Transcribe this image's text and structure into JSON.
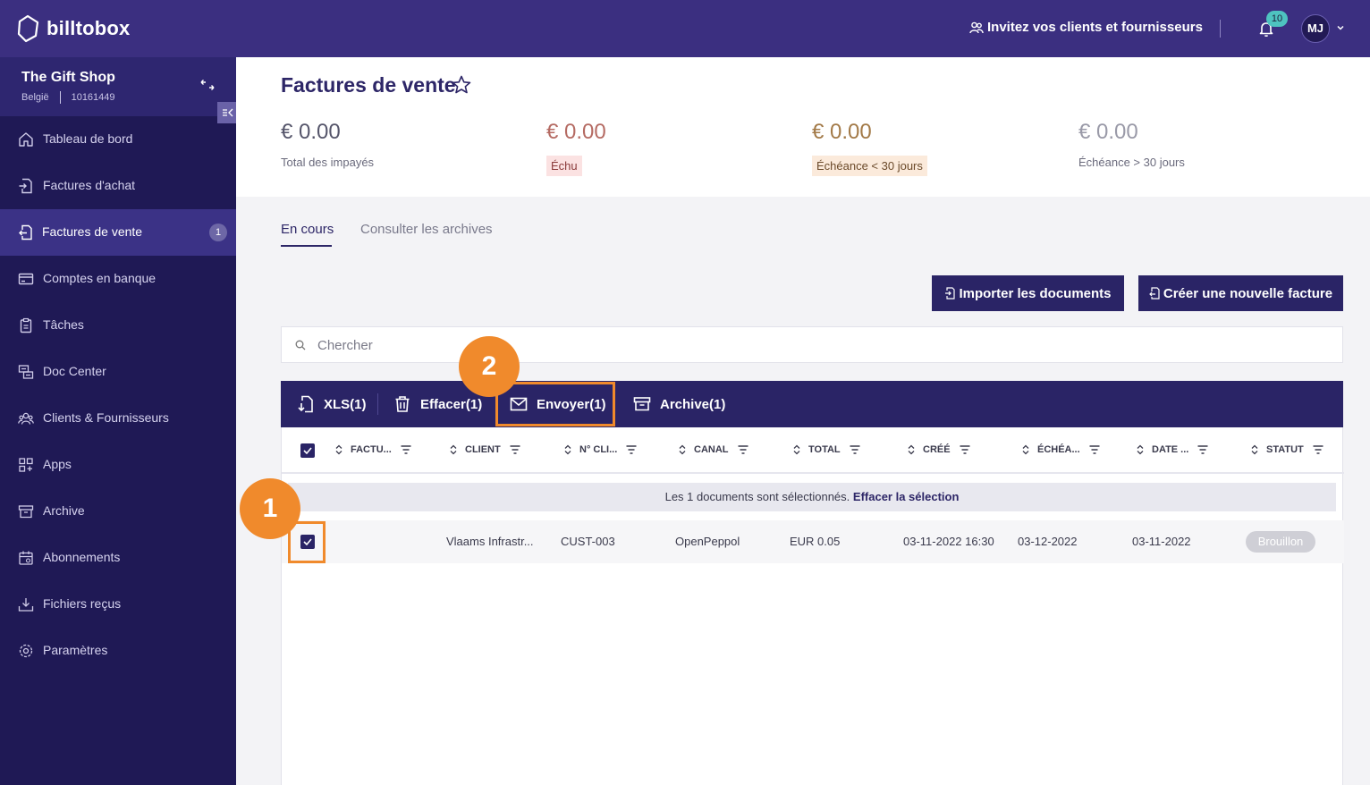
{
  "app": {
    "brand": "billtobox",
    "invite_label": "Invitez vos clients et fournisseurs",
    "notification_count": "10",
    "user_initials": "MJ"
  },
  "company": {
    "name": "The Gift Shop",
    "country": "België",
    "number": "10161449"
  },
  "sidebar": {
    "items": [
      {
        "label": "Tableau de bord",
        "icon": "home-icon"
      },
      {
        "label": "Factures d'achat",
        "icon": "purchase-invoice-icon"
      },
      {
        "label": "Factures de vente",
        "icon": "sales-invoice-icon",
        "badge": "1",
        "active": true
      },
      {
        "label": "Comptes en banque",
        "icon": "bank-card-icon"
      },
      {
        "label": "Tâches",
        "icon": "clipboard-icon"
      },
      {
        "label": "Doc Center",
        "icon": "doc-center-icon"
      },
      {
        "label": "Clients & Fournisseurs",
        "icon": "users-icon"
      },
      {
        "label": "Apps",
        "icon": "apps-icon"
      },
      {
        "label": "Archive",
        "icon": "archive-icon"
      },
      {
        "label": "Abonnements",
        "icon": "calendar-icon"
      },
      {
        "label": "Fichiers reçus",
        "icon": "download-tray-icon"
      },
      {
        "label": "Paramètres",
        "icon": "gear-icon"
      }
    ]
  },
  "page": {
    "title": "Factures de vente"
  },
  "stats": [
    {
      "amount": "€ 0.00",
      "label": "Total des impayés"
    },
    {
      "amount": "€ 0.00",
      "label": "Échu"
    },
    {
      "amount": "€ 0.00",
      "label": "Échéance < 30 jours"
    },
    {
      "amount": "€ 0.00",
      "label": "Échéance > 30 jours"
    }
  ],
  "tabs": {
    "current": "En cours",
    "archive": "Consulter les archives"
  },
  "buttons": {
    "import": "Importer les documents",
    "create": "Créer une nouvelle facture"
  },
  "search": {
    "placeholder": "Chercher"
  },
  "actions": {
    "xls": "XLS(1)",
    "delete": "Effacer(1)",
    "send": "Envoyer(1)",
    "archive": "Archive(1)"
  },
  "table": {
    "columns": [
      "FACTU...",
      "CLIENT",
      "N° CLI...",
      "CANAL",
      "TOTAL",
      "CRÉÉ",
      "ÉCHÉA...",
      "DATE ...",
      "STATUT"
    ],
    "selection_text": "Les 1 documents sont sélectionnés.",
    "clear_selection": "Effacer la sélection",
    "rows": [
      {
        "invoice": "",
        "client": "Vlaams Infrastr...",
        "client_no": "CUST-003",
        "channel": "OpenPeppol",
        "total": "EUR 0.05",
        "created": "03-11-2022 16:30",
        "due": "03-12-2022",
        "date": "03-11-2022",
        "status": "Brouillon"
      }
    ]
  },
  "steps": {
    "step1": "1",
    "step2": "2"
  },
  "colors": {
    "topbar": "#3b2f80",
    "sidebar": "#1f1955",
    "accent": "#2a2466",
    "highlight": "#f08a2c"
  }
}
